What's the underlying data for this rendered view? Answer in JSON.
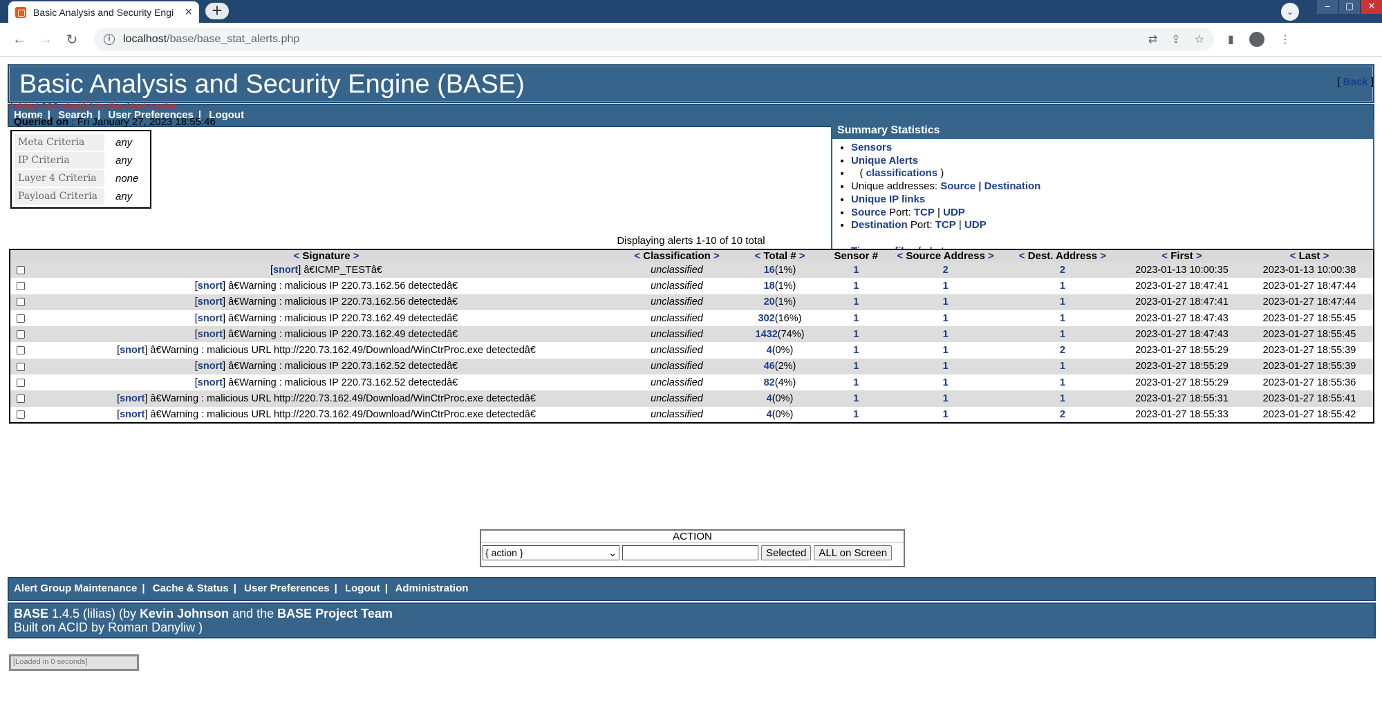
{
  "browser": {
    "tab_title": "Basic Analysis and Security Engi",
    "url_host": "localhost",
    "url_path": "/base/base_stat_alerts.php"
  },
  "header": {
    "title": "Basic Analysis and Security Engine (BASE)",
    "nav": [
      "Home",
      "Search",
      "User Preferences",
      "Logout"
    ]
  },
  "back_label": "Back",
  "cache_message": "Added 208 alert(s) to the Alert cache",
  "queried": {
    "label": "Queried on",
    "value": ": Fri January 27, 2023 18:55:46"
  },
  "criteria": [
    {
      "label": "Meta Criteria",
      "value": "any"
    },
    {
      "label": "IP Criteria",
      "value": "any"
    },
    {
      "label": "Layer 4 Criteria",
      "value": "none"
    },
    {
      "label": "Payload Criteria",
      "value": "any"
    }
  ],
  "summary": {
    "title": "Summary Statistics",
    "sensors": "Sensors",
    "unique_alerts": "Unique Alerts",
    "classifications": "classifications",
    "unique_addresses_label": "Unique addresses:",
    "source": "Source",
    "destination": "Destination",
    "unique_ip_links": "Unique IP links",
    "source_port_label": "Source",
    "dest_port_label": "Destination",
    "port_word": "Port:",
    "tcp": "TCP",
    "udp": "UDP",
    "time_profile": "Time profile",
    "of_alerts": "of alerts"
  },
  "displaying": "Displaying alerts 1-10 of 10 total",
  "table": {
    "headers": {
      "signature": "Signature",
      "classification": "Classification",
      "total": "Total #",
      "sensor": "Sensor #",
      "source": "Source Address",
      "dest": "Dest. Address",
      "first": "First",
      "last": "Last"
    },
    "rows": [
      {
        "tag": "snort",
        "msg": "â€ICMP_TESTâ€",
        "cls": "unclassified",
        "total": "16",
        "pct": "(1%)",
        "sensor": "1",
        "src": "2",
        "dst": "2",
        "first": "2023-01-13 10:00:35",
        "last": "2023-01-13 10:00:38"
      },
      {
        "tag": "snort",
        "msg": "â€Warning : malicious IP 220.73.162.56 detectedâ€",
        "cls": "unclassified",
        "total": "18",
        "pct": "(1%)",
        "sensor": "1",
        "src": "1",
        "dst": "1",
        "first": "2023-01-27 18:47:41",
        "last": "2023-01-27 18:47:44"
      },
      {
        "tag": "snort",
        "msg": "â€Warning : malicious IP 220.73.162.56 detectedâ€",
        "cls": "unclassified",
        "total": "20",
        "pct": "(1%)",
        "sensor": "1",
        "src": "1",
        "dst": "1",
        "first": "2023-01-27 18:47:41",
        "last": "2023-01-27 18:47:44"
      },
      {
        "tag": "snort",
        "msg": "â€Warning : malicious IP 220.73.162.49 detectedâ€",
        "cls": "unclassified",
        "total": "302",
        "pct": "(16%)",
        "sensor": "1",
        "src": "1",
        "dst": "1",
        "first": "2023-01-27 18:47:43",
        "last": "2023-01-27 18:55:45"
      },
      {
        "tag": "snort",
        "msg": "â€Warning : malicious IP 220.73.162.49 detectedâ€",
        "cls": "unclassified",
        "total": "1432",
        "pct": "(74%)",
        "sensor": "1",
        "src": "1",
        "dst": "1",
        "first": "2023-01-27 18:47:43",
        "last": "2023-01-27 18:55:45"
      },
      {
        "tag": "snort",
        "msg": "â€Warning : malicious URL http://220.73.162.49/Download/WinCtrProc.exe detectedâ€",
        "cls": "unclassified",
        "total": "4",
        "pct": "(0%)",
        "sensor": "1",
        "src": "1",
        "dst": "2",
        "first": "2023-01-27 18:55:29",
        "last": "2023-01-27 18:55:39"
      },
      {
        "tag": "snort",
        "msg": "â€Warning : malicious IP 220.73.162.52 detectedâ€",
        "cls": "unclassified",
        "total": "46",
        "pct": "(2%)",
        "sensor": "1",
        "src": "1",
        "dst": "1",
        "first": "2023-01-27 18:55:29",
        "last": "2023-01-27 18:55:39"
      },
      {
        "tag": "snort",
        "msg": "â€Warning : malicious IP 220.73.162.52 detectedâ€",
        "cls": "unclassified",
        "total": "82",
        "pct": "(4%)",
        "sensor": "1",
        "src": "1",
        "dst": "1",
        "first": "2023-01-27 18:55:29",
        "last": "2023-01-27 18:55:36"
      },
      {
        "tag": "snort",
        "msg": "â€Warning : malicious URL http://220.73.162.49/Download/WinCtrProc.exe detectedâ€",
        "cls": "unclassified",
        "total": "4",
        "pct": "(0%)",
        "sensor": "1",
        "src": "1",
        "dst": "1",
        "first": "2023-01-27 18:55:31",
        "last": "2023-01-27 18:55:41"
      },
      {
        "tag": "snort",
        "msg": "â€Warning : malicious URL http://220.73.162.49/Download/WinCtrProc.exe detectedâ€",
        "cls": "unclassified",
        "total": "4",
        "pct": "(0%)",
        "sensor": "1",
        "src": "1",
        "dst": "2",
        "first": "2023-01-27 18:55:33",
        "last": "2023-01-27 18:55:42"
      }
    ]
  },
  "action": {
    "title": "ACTION",
    "select_value": "{ action }",
    "selected_btn": "Selected",
    "all_btn": "ALL on Screen"
  },
  "footer": {
    "nav": [
      "Alert Group Maintenance",
      "Cache & Status",
      "User Preferences",
      "Logout",
      "Administration"
    ],
    "base": "BASE",
    "version": " 1.4.5 (lilias) (by ",
    "author": "Kevin Johnson",
    "and_the": " and the ",
    "team": "BASE Project Team",
    "built_on": "Built on ACID by Roman Danyliw )",
    "loaded": "[Loaded in 0 seconds]"
  }
}
